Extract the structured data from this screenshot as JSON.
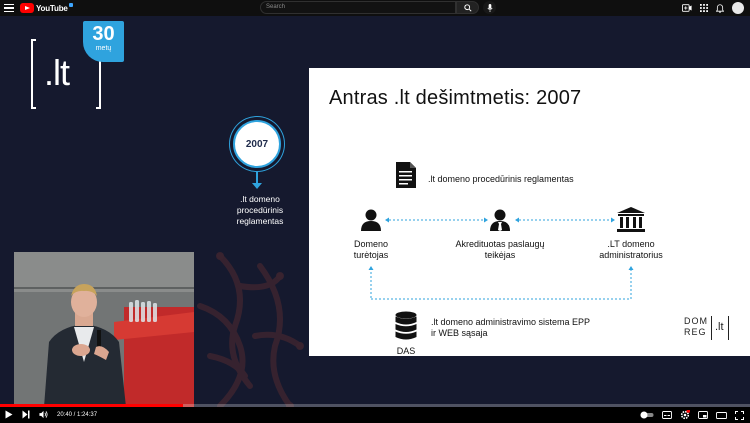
{
  "header": {
    "logo_text": "YouTube",
    "search_placeholder": "Search"
  },
  "video": {
    "brand": {
      "lt_mark": ".lt",
      "badge_number": "30",
      "badge_sub": "metų"
    },
    "timeline": {
      "year": "2007",
      "caption": ".lt domeno procedūrinis reglamentas"
    },
    "slide": {
      "title": "Antras .lt dešimtmetis: 2007",
      "doc_label": ".lt domeno procedūrinis reglamentas",
      "holder_label": "Domeno turėtojas",
      "registrar_label": "Akredituotas paslaugų teikėjas",
      "admin_label": ".LT domeno administratorius",
      "das_label": "DAS",
      "system_label": ".lt domeno administravimo sistema EPP ir WEB sąsaja",
      "logo_text_top": "DOM",
      "logo_text_bottom": "REG",
      "logo_lt": ".lt"
    }
  },
  "player": {
    "time_display": "20:40 / 1:24:37",
    "progress_fraction": 0.244,
    "accent_color": "#ff0000",
    "slide_accent": "#2fa3de"
  },
  "icons": [
    "menu-icon",
    "search-icon",
    "mic-icon",
    "create-icon",
    "apps-icon",
    "bell-icon",
    "play-icon",
    "next-icon",
    "volume-icon",
    "autoplay-toggle",
    "subtitles-icon",
    "settings-icon",
    "miniplayer-icon",
    "theater-icon",
    "fullscreen-icon",
    "document-icon",
    "person-icon",
    "businessman-icon",
    "bank-icon",
    "database-icon"
  ]
}
